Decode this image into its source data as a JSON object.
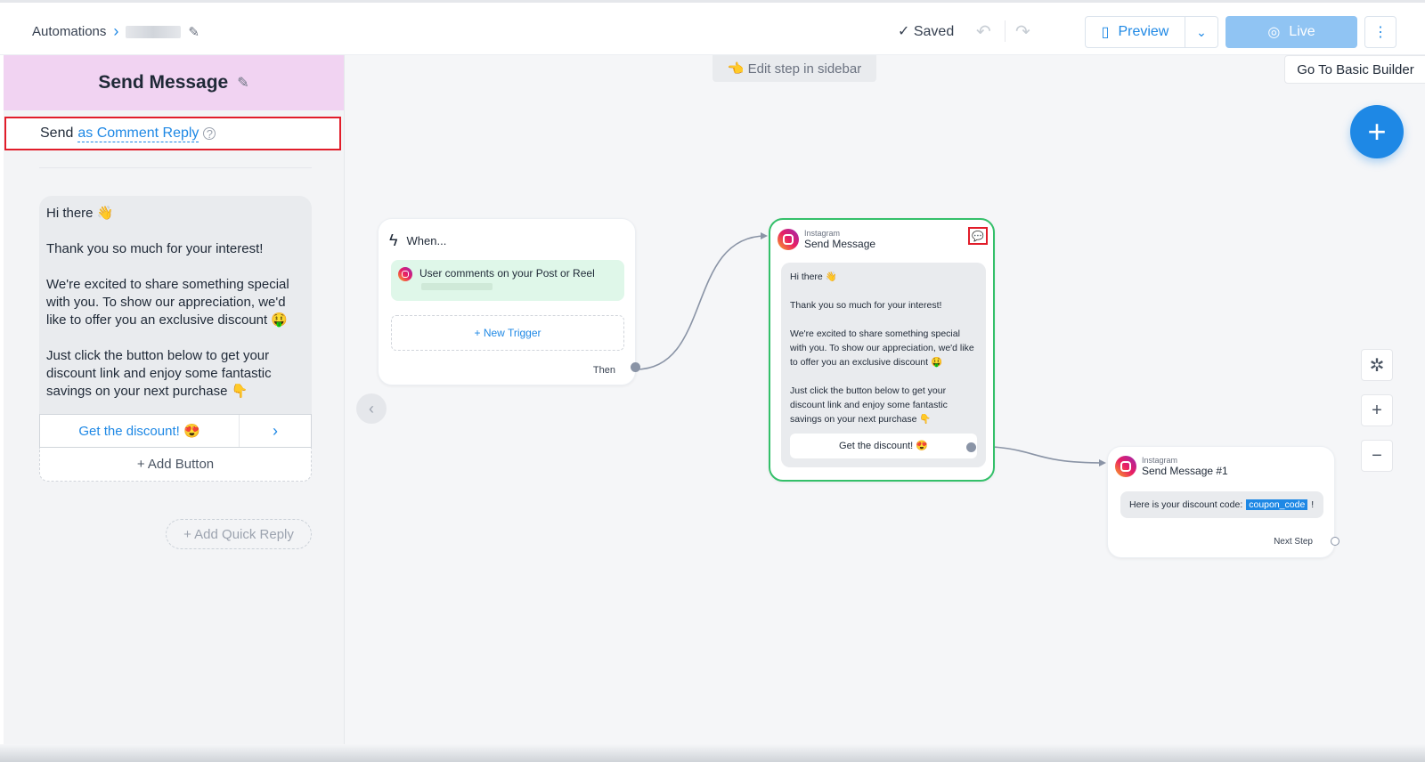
{
  "topbar": {
    "breadcrumb_root": "Automations",
    "saved_label": "Saved",
    "preview_label": "Preview",
    "live_label": "Live"
  },
  "sidebar": {
    "title": "Send Message",
    "send_prefix": "Send",
    "send_mode": "as Comment Reply",
    "message_paragraphs": [
      "Hi there 👋",
      "Thank you so much for your interest!",
      "We're excited to share something special with you. To show our appreciation, we'd like to offer you an exclusive discount 🤑",
      "Just click the button below to get your discount link and enjoy some fantastic savings on your next purchase 👇"
    ],
    "button_label": "Get the discount! 😍",
    "add_button_label": "+ Add Button",
    "add_quick_reply_label": "+ Add Quick Reply"
  },
  "canvas": {
    "hint": "👈 Edit step in sidebar",
    "basic_builder_label": "Go To Basic Builder",
    "trigger": {
      "when_label": "When...",
      "trigger_text": "User comments on your Post or Reel",
      "new_trigger_label": "+ New Trigger",
      "then_label": "Then"
    },
    "send_card": {
      "platform": "Instagram",
      "title": "Send Message",
      "paragraphs": [
        "Hi there 👋",
        "Thank you so much for your interest!",
        "We're excited to share something special with you. To show our appreciation, we'd like to offer you an exclusive discount 🤑",
        "Just click the button below to get your discount link and enjoy some fantastic savings on your next purchase 👇"
      ],
      "button_label": "Get the discount! 😍"
    },
    "send_card2": {
      "platform": "Instagram",
      "title": "Send Message #1",
      "message_prefix": "Here is your discount code:",
      "code": "coupon_code",
      "suffix": "!",
      "next_step_label": "Next Step"
    }
  },
  "colors": {
    "accent": "#1e88e5",
    "sidebar_header": "#f1d3f2",
    "selected_border": "#34c06a",
    "highlight_red": "#e11d2a"
  }
}
